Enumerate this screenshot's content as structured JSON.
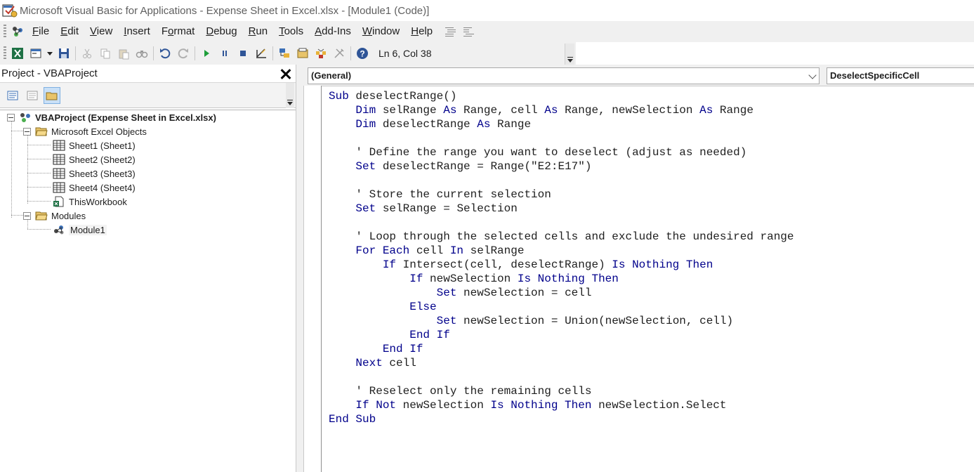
{
  "window": {
    "title": "Microsoft Visual Basic for Applications - Expense Sheet in Excel.xlsx - [Module1 (Code)]"
  },
  "menu": [
    {
      "key": "F",
      "rest": "ile"
    },
    {
      "key": "E",
      "rest": "dit"
    },
    {
      "key": "V",
      "rest": "iew"
    },
    {
      "key": "I",
      "rest": "nsert"
    },
    {
      "key": "F",
      "rest": "ormat",
      "pre": ""
    },
    {
      "key": "D",
      "rest": "ebug"
    },
    {
      "key": "R",
      "rest": "un"
    },
    {
      "key": "T",
      "rest": "ools"
    },
    {
      "key": "A",
      "rest": "dd-Ins"
    },
    {
      "key": "W",
      "rest": "indow"
    },
    {
      "key": "H",
      "rest": "elp"
    }
  ],
  "menu_labels": {
    "file": "File",
    "edit": "Edit",
    "view": "View",
    "insert": "Insert",
    "format": "Format",
    "debug": "Debug",
    "run": "Run",
    "tools": "Tools",
    "addins": "Add-Ins",
    "window": "Window",
    "help": "Help"
  },
  "toolbar": {
    "status": "Ln 6, Col 38"
  },
  "project": {
    "title": "Project - VBAProject",
    "root": "VBAProject (Expense Sheet in Excel.xlsx)",
    "excel_objects_folder": "Microsoft Excel Objects",
    "sheets": [
      "Sheet1 (Sheet1)",
      "Sheet2 (Sheet2)",
      "Sheet3 (Sheet3)",
      "Sheet4 (Sheet4)"
    ],
    "workbook": "ThisWorkbook",
    "modules_folder": "Modules",
    "module": "Module1"
  },
  "code_window": {
    "object_dropdown": "(General)",
    "procedure_dropdown": "DeselectSpecificCell"
  },
  "colors": {
    "keyword": "#00008b",
    "text": "#1e1e1e",
    "toolbar_bg": "#f0f0f0"
  },
  "code_lines": [
    [
      [
        "kw",
        "Sub"
      ],
      [
        "t",
        " deselectRange()"
      ]
    ],
    [
      [
        "t",
        "    "
      ],
      [
        "kw",
        "Dim"
      ],
      [
        "t",
        " selRange "
      ],
      [
        "kw",
        "As"
      ],
      [
        "t",
        " Range, cell "
      ],
      [
        "kw",
        "As"
      ],
      [
        "t",
        " Range, newSelection "
      ],
      [
        "kw",
        "As"
      ],
      [
        "t",
        " Range"
      ]
    ],
    [
      [
        "t",
        "    "
      ],
      [
        "kw",
        "Dim"
      ],
      [
        "t",
        " deselectRange "
      ],
      [
        "kw",
        "As"
      ],
      [
        "t",
        " Range"
      ]
    ],
    [
      [
        "t",
        ""
      ]
    ],
    [
      [
        "t",
        "    ' Define the range you want to deselect (adjust as needed)"
      ]
    ],
    [
      [
        "t",
        "    "
      ],
      [
        "kw",
        "Set"
      ],
      [
        "t",
        " deselectRange = Range(\"E2:E17\")"
      ]
    ],
    [
      [
        "t",
        ""
      ]
    ],
    [
      [
        "t",
        "    ' Store the current selection"
      ]
    ],
    [
      [
        "t",
        "    "
      ],
      [
        "kw",
        "Set"
      ],
      [
        "t",
        " selRange = Selection"
      ]
    ],
    [
      [
        "t",
        ""
      ]
    ],
    [
      [
        "t",
        "    ' Loop through the selected cells and exclude the undesired range"
      ]
    ],
    [
      [
        "t",
        "    "
      ],
      [
        "kw",
        "For Each"
      ],
      [
        "t",
        " cell "
      ],
      [
        "kw",
        "In"
      ],
      [
        "t",
        " selRange"
      ]
    ],
    [
      [
        "t",
        "        "
      ],
      [
        "kw",
        "If"
      ],
      [
        "t",
        " Intersect(cell, deselectRange) "
      ],
      [
        "kw",
        "Is Nothing Then"
      ]
    ],
    [
      [
        "t",
        "            "
      ],
      [
        "kw",
        "If"
      ],
      [
        "t",
        " newSelection "
      ],
      [
        "kw",
        "Is Nothing Then"
      ]
    ],
    [
      [
        "t",
        "                "
      ],
      [
        "kw",
        "Set"
      ],
      [
        "t",
        " newSelection = cell"
      ]
    ],
    [
      [
        "t",
        "            "
      ],
      [
        "kw",
        "Else"
      ]
    ],
    [
      [
        "t",
        "                "
      ],
      [
        "kw",
        "Set"
      ],
      [
        "t",
        " newSelection = Union(newSelection, cell)"
      ]
    ],
    [
      [
        "t",
        "            "
      ],
      [
        "kw",
        "End If"
      ]
    ],
    [
      [
        "t",
        "        "
      ],
      [
        "kw",
        "End If"
      ]
    ],
    [
      [
        "t",
        "    "
      ],
      [
        "kw",
        "Next"
      ],
      [
        "t",
        " cell"
      ]
    ],
    [
      [
        "t",
        ""
      ]
    ],
    [
      [
        "t",
        "    ' Reselect only the remaining cells"
      ]
    ],
    [
      [
        "t",
        "    "
      ],
      [
        "kw",
        "If Not"
      ],
      [
        "t",
        " newSelection "
      ],
      [
        "kw",
        "Is Nothing Then"
      ],
      [
        "t",
        " newSelection.Select"
      ]
    ],
    [
      [
        "kw",
        "End Sub"
      ]
    ]
  ]
}
